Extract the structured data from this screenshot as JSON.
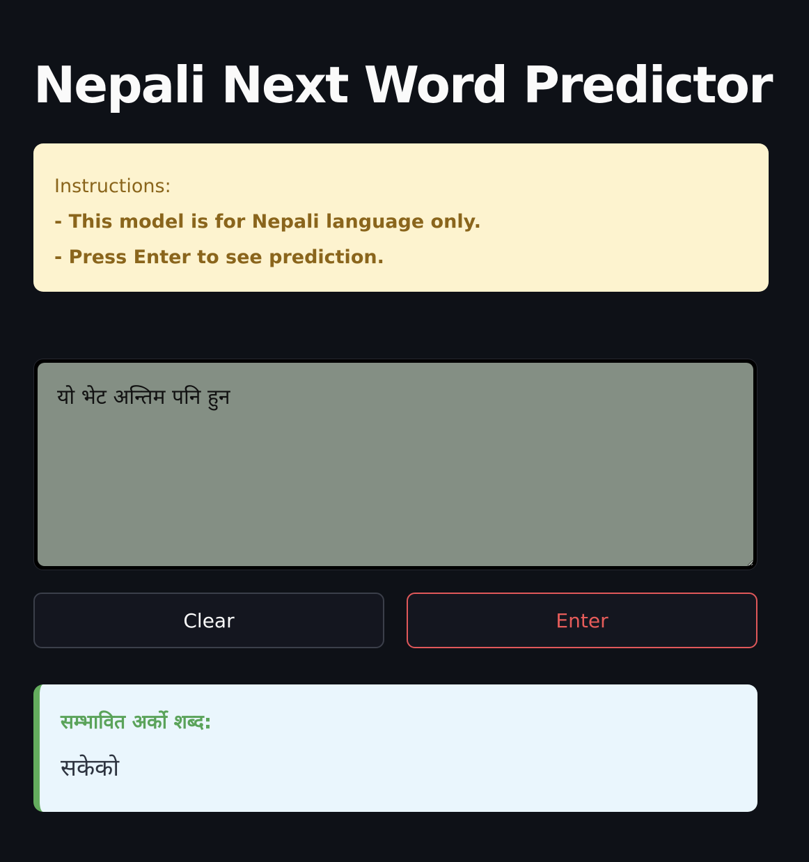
{
  "header": {
    "title": "Nepali Next Word Predictor"
  },
  "instructions": {
    "heading": "Instructions:",
    "lines": [
      "- This model is for Nepali language only.",
      "- Press Enter to see prediction."
    ]
  },
  "input": {
    "value": "यो भेट अन्तिम पनि हुन"
  },
  "buttons": {
    "clear_label": "Clear",
    "enter_label": "Enter"
  },
  "result": {
    "label": "सम्भावित अर्को शब्द:",
    "value": "सकेको"
  },
  "colors": {
    "background": "#0e1117",
    "instructions_bg": "#fdf3cf",
    "instructions_text": "#8a651c",
    "input_bg": "#848f84",
    "enter_accent": "#e65c5a",
    "result_bg": "#eaf6fd",
    "result_accent": "#64ad5e"
  }
}
